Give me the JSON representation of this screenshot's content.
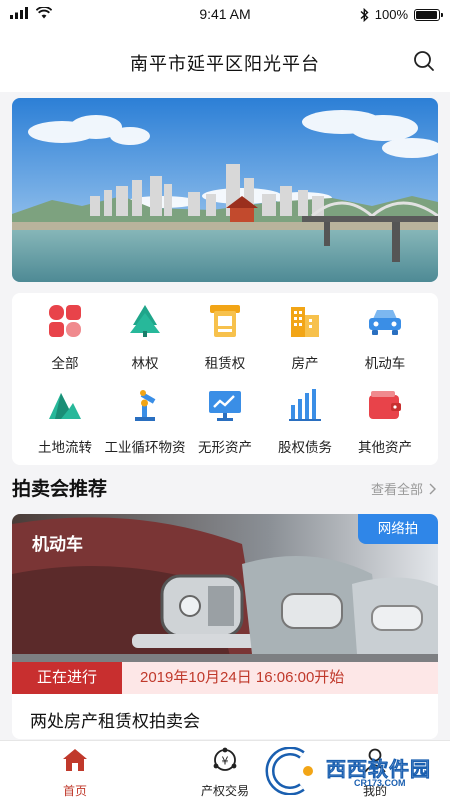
{
  "status_bar": {
    "time": "9:41 AM",
    "battery": "100%",
    "battery_level": 1.0
  },
  "header": {
    "title": "南平市延平区阳光平台",
    "search_icon": "search-icon"
  },
  "banner": {
    "alt": "city-skyline-river-banner"
  },
  "categories": [
    {
      "label": "全部",
      "icon": "clover-grid-icon",
      "color": "#e8434a"
    },
    {
      "label": "林权",
      "icon": "tree-icon",
      "color": "#1fa58a"
    },
    {
      "label": "租赁权",
      "icon": "lease-document-icon",
      "color": "#f2a516"
    },
    {
      "label": "房产",
      "icon": "building-icon",
      "color": "#f2a516"
    },
    {
      "label": "机动车",
      "icon": "car-icon",
      "color": "#3a8ee6"
    },
    {
      "label": "土地流转",
      "icon": "mountain-land-icon",
      "color": "#1fa58a"
    },
    {
      "label": "工业循环物资",
      "icon": "robot-arm-icon",
      "color": "#3a8ee6"
    },
    {
      "label": "无形资产",
      "icon": "monitor-chart-icon",
      "color": "#3a8ee6"
    },
    {
      "label": "股权债务",
      "icon": "bar-chart-icon",
      "color": "#3a8ee6"
    },
    {
      "label": "其他资产",
      "icon": "wallet-icon",
      "color": "#e8434a"
    }
  ],
  "recommend": {
    "title": "拍卖会推荐",
    "more": "查看全部"
  },
  "auction": {
    "category": "机动车",
    "badge": "网络拍",
    "status": "正在进行",
    "time": "2019年10月24日   16:06:00开始",
    "name": "两处房产租赁权拍卖会"
  },
  "tabbar": {
    "items": [
      {
        "label": "首页",
        "icon": "home-icon",
        "active": true
      },
      {
        "label": "产权交易",
        "icon": "yen-exchange-icon",
        "active": false
      },
      {
        "label": "我的",
        "icon": "user-icon",
        "active": false
      }
    ]
  },
  "watermark": {
    "text": "西西软件园",
    "sub": "CR173.COM"
  }
}
